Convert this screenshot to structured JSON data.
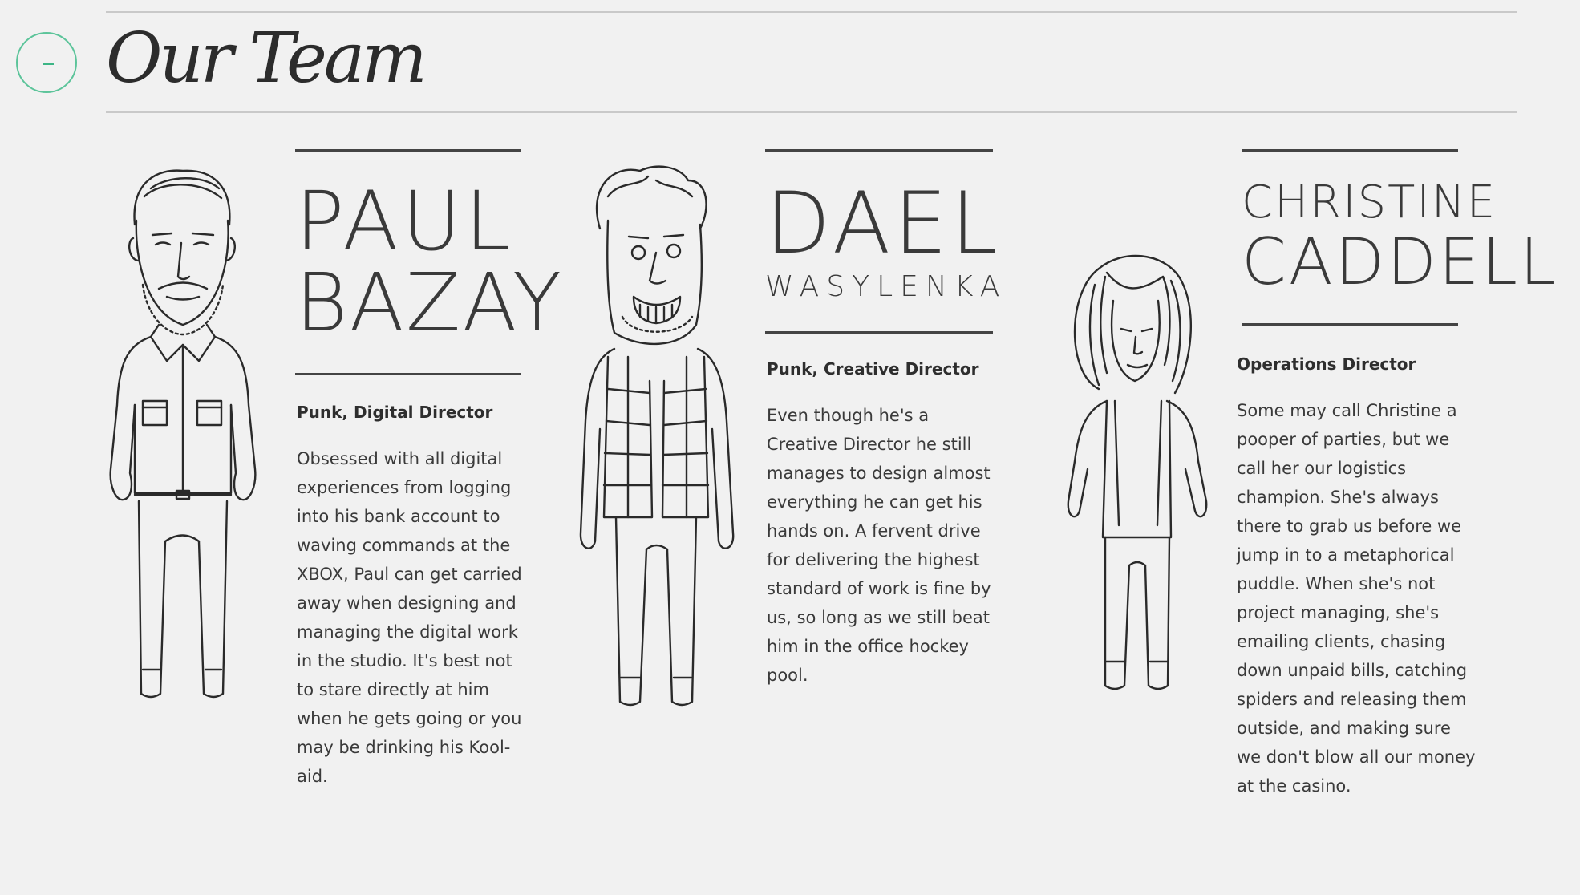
{
  "page": {
    "title": "Our Team",
    "collapse_icon": "minus-circle-icon",
    "accent_color": "#3cb585"
  },
  "team": [
    {
      "name_line1": "PAUL",
      "name_line2": "BAZAY",
      "role": "Punk, Digital Director",
      "bio": "Obsessed with all digital experiences from logging into his bank account to waving commands at the XBOX, Paul can get carried away when designing and managing the digital work in the studio. It's best not to stare directly at him when he gets going or you may be drinking his Kool-aid."
    },
    {
      "name_line1": "DAEL",
      "name_line2": "WASYLENKA",
      "role": "Punk, Creative Director",
      "bio": "Even though he's a Creative Director he still manages to design almost everything he can get his hands on. A fervent drive for delivering the highest standard of work is fine by us, so long as we still beat him in the office hockey pool."
    },
    {
      "name_line1": "CHRISTINE",
      "name_line2": "CADDELL",
      "role": "Operations Director",
      "bio": "Some may call Christine a pooper of parties, but we call her our logistics champion. She's always there to grab us before we jump in to a metaphorical puddle. When she's not project managing, she's emailing clients, chasing down unpaid bills, catching spiders and releasing them outside, and making sure we don't blow all our money at the casino."
    }
  ]
}
